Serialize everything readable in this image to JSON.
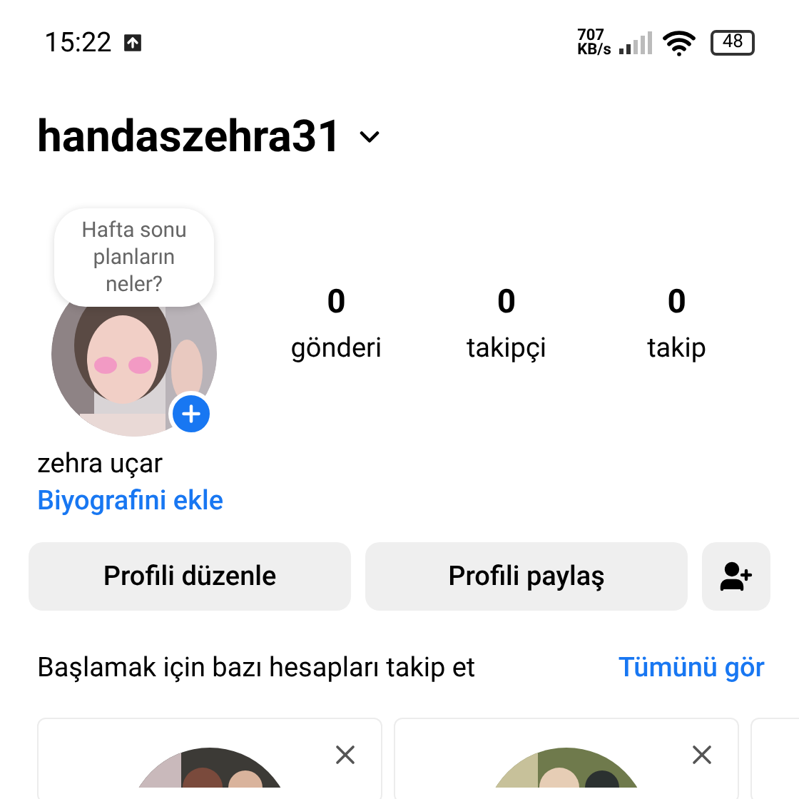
{
  "status_bar": {
    "time": "15:22",
    "speed": "707",
    "speed_unit": "KB/s",
    "battery": "48"
  },
  "header": {
    "username": "handaszehra31"
  },
  "profile": {
    "note": "Hafta sonu planların neler?",
    "stats": [
      {
        "value": "0",
        "label": "gönderi"
      },
      {
        "value": "0",
        "label": "takipçi"
      },
      {
        "value": "0",
        "label": "takip"
      }
    ],
    "name": "zehra uçar",
    "bio_link": "Biyografini ekle"
  },
  "buttons": [
    "Profili düzenle",
    "Profili paylaş"
  ],
  "suggestions": {
    "title": "Başlamak için bazı hesapları takip et",
    "see_all": "Tümünü gör",
    "cards": [
      {
        "kind": "picture"
      },
      {
        "kind": "picture"
      },
      {
        "kind": "empty"
      }
    ]
  }
}
